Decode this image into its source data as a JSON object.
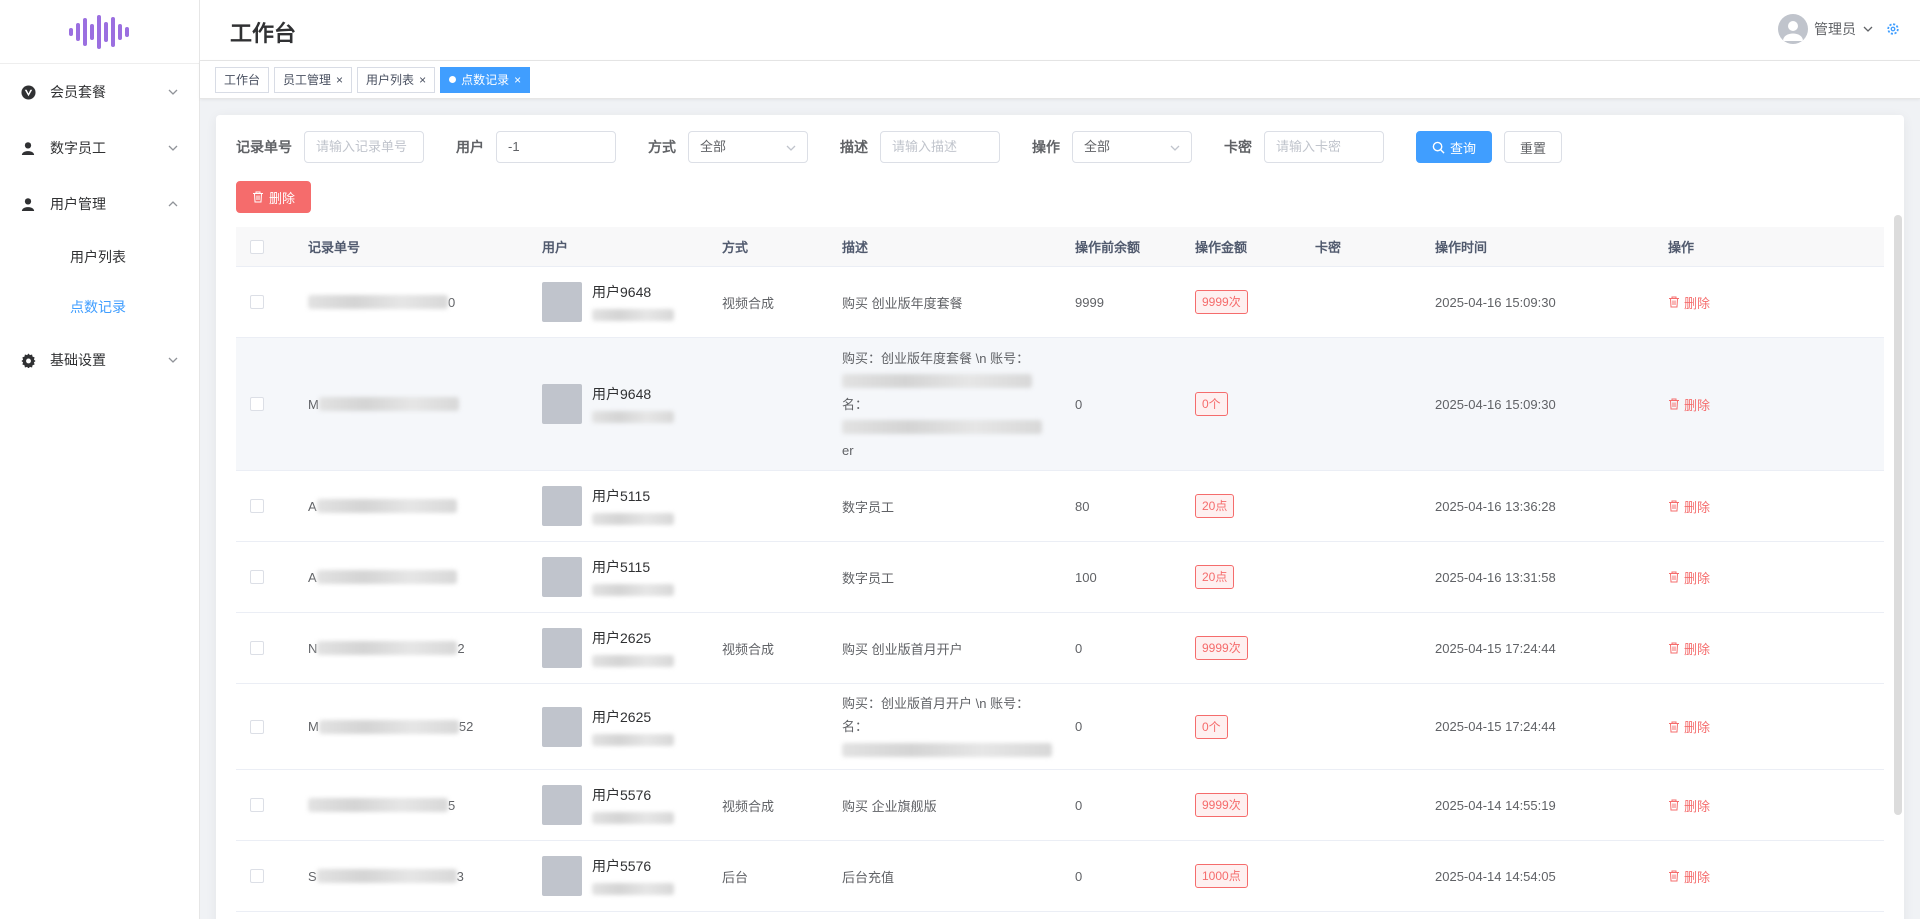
{
  "header": {
    "title": "工作台",
    "user_name": "管理员"
  },
  "tags": [
    {
      "label": "工作台"
    },
    {
      "label": "员工管理"
    },
    {
      "label": "用户列表"
    },
    {
      "label": "点数记录"
    }
  ],
  "sidebar": {
    "menus": [
      {
        "label": "会员套餐"
      },
      {
        "label": "数字员工"
      },
      {
        "label": "用户管理"
      },
      {
        "label": "基础设置"
      }
    ],
    "submenus": [
      {
        "label": "用户列表"
      },
      {
        "label": "点数记录"
      }
    ]
  },
  "filters": {
    "record_no_label": "记录单号",
    "record_no_placeholder": "请输入记录单号",
    "user_label": "用户",
    "user_value": "-1",
    "way_label": "方式",
    "way_value": "全部",
    "desc_label": "描述",
    "desc_placeholder": "请输入描述",
    "op_label": "操作",
    "op_value": "全部",
    "card_label": "卡密",
    "card_placeholder": "请输入卡密",
    "query_label": "查询",
    "reset_label": "重置",
    "delete_label": "删除"
  },
  "table": {
    "headers": [
      "记录单号",
      "用户",
      "方式",
      "描述",
      "操作前余额",
      "操作金额",
      "卡密",
      "操作时间",
      "操作"
    ],
    "delete_label": "删除",
    "rows": [
      {
        "id_pre": "",
        "id_suf": "0",
        "user": "用户9648",
        "way": "视频合成",
        "desc": "购买 创业版年度套餐",
        "desc_lines": [],
        "before": "9999",
        "amount": "9999次",
        "card": "",
        "time": "2025-04-16 15:09:30"
      },
      {
        "id_pre": "M",
        "id_suf": "",
        "user": "用户9648",
        "way": "",
        "desc": "",
        "desc_lines": [
          "购买：创业版年度套餐 \\n 账号：",
          "",
          "名：",
          "",
          "er"
        ],
        "before": "0",
        "amount": "0个",
        "card": "",
        "time": "2025-04-16 15:09:30"
      },
      {
        "id_pre": "A",
        "id_suf": "",
        "user": "用户5115",
        "way": "",
        "desc": "数字员工",
        "desc_lines": [],
        "before": "80",
        "amount": "20点",
        "card": "",
        "time": "2025-04-16 13:36:28"
      },
      {
        "id_pre": "A",
        "id_suf": "",
        "user": "用户5115",
        "way": "",
        "desc": "数字员工",
        "desc_lines": [],
        "before": "100",
        "amount": "20点",
        "card": "",
        "time": "2025-04-16 13:31:58"
      },
      {
        "id_pre": "N",
        "id_suf": "2",
        "user": "用户2625",
        "way": "视频合成",
        "desc": "购买 创业版首月开户",
        "desc_lines": [],
        "before": "0",
        "amount": "9999次",
        "card": "",
        "time": "2025-04-15 17:24:44"
      },
      {
        "id_pre": "M",
        "id_suf": "52",
        "user": "用户2625",
        "way": "",
        "desc": "",
        "desc_lines": [
          "购买：创业版首月开户 \\n 账号：",
          "名：",
          ""
        ],
        "before": "0",
        "amount": "0个",
        "card": "",
        "time": "2025-04-15 17:24:44"
      },
      {
        "id_pre": "",
        "id_suf": "5",
        "user": "用户5576",
        "way": "视频合成",
        "desc": "购买 企业旗舰版",
        "desc_lines": [],
        "before": "0",
        "amount": "9999次",
        "card": "",
        "time": "2025-04-14 14:55:19"
      },
      {
        "id_pre": "S",
        "id_suf": "3",
        "user": "用户5576",
        "way": "后台",
        "desc": "后台充值",
        "desc_lines": [],
        "before": "0",
        "amount": "1000点",
        "card": "",
        "time": "2025-04-14 14:54:05"
      }
    ]
  },
  "colors": {
    "primary": "#409eff",
    "danger": "#f56c6c",
    "logo": "#9b6fe0"
  },
  "icons": [
    "logo-waveform-icon",
    "vuejs-icon",
    "user-icon",
    "gear-icon",
    "chevron-down-icon",
    "chevron-up-icon",
    "search-icon",
    "trash-icon",
    "close-icon",
    "settings-icon"
  ]
}
